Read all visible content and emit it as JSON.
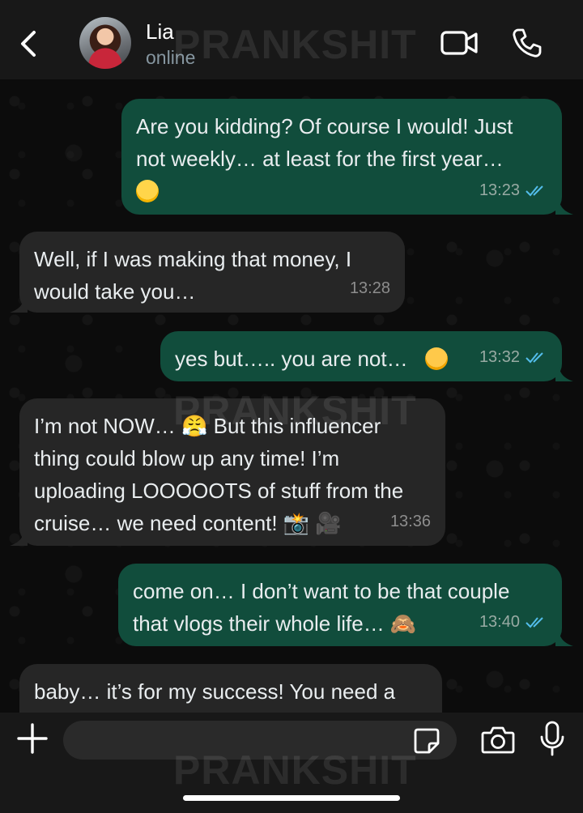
{
  "header": {
    "contact_name": "Lia",
    "status": "online",
    "watermark": "PRANKSHIT"
  },
  "messages": [
    {
      "direction": "out",
      "text": "Are you kidding? Of course I would! Just\nnot weekly… at least for the first year…",
      "emoji": "grimacing-face",
      "time": "13:23",
      "read": true
    },
    {
      "direction": "in",
      "text": "Well, if I was making that money, I\nwould take you…",
      "time": "13:28"
    },
    {
      "direction": "out",
      "text": "yes but….. you are not…",
      "emoji": "flushed-face",
      "time": "13:32",
      "read": true
    },
    {
      "direction": "in",
      "text": "I’m not NOW… 😤 But this influencer\nthing could blow up any time! I’m\nuploading LOOOOOTS of stuff from the\ncruise… we need content! 📸 🎥",
      "time": "13:36"
    },
    {
      "direction": "out",
      "text": "come on… I don’t want to be that couple\nthat vlogs their whole life… 🙈",
      "time": "13:40",
      "read": true
    },
    {
      "direction": "in",
      "text": "baby… it’s for my success! You need a",
      "time": ""
    }
  ],
  "composer": {
    "placeholder": ""
  },
  "colors": {
    "outgoing_bubble": "#114d3c",
    "incoming_bubble": "#262626",
    "read_ticks": "#53bdeb",
    "background": "#0c0c0c"
  },
  "icons": [
    "back-chevron-icon",
    "video-call-icon",
    "phone-icon",
    "plus-icon",
    "sticker-icon",
    "camera-icon",
    "microphone-icon"
  ]
}
